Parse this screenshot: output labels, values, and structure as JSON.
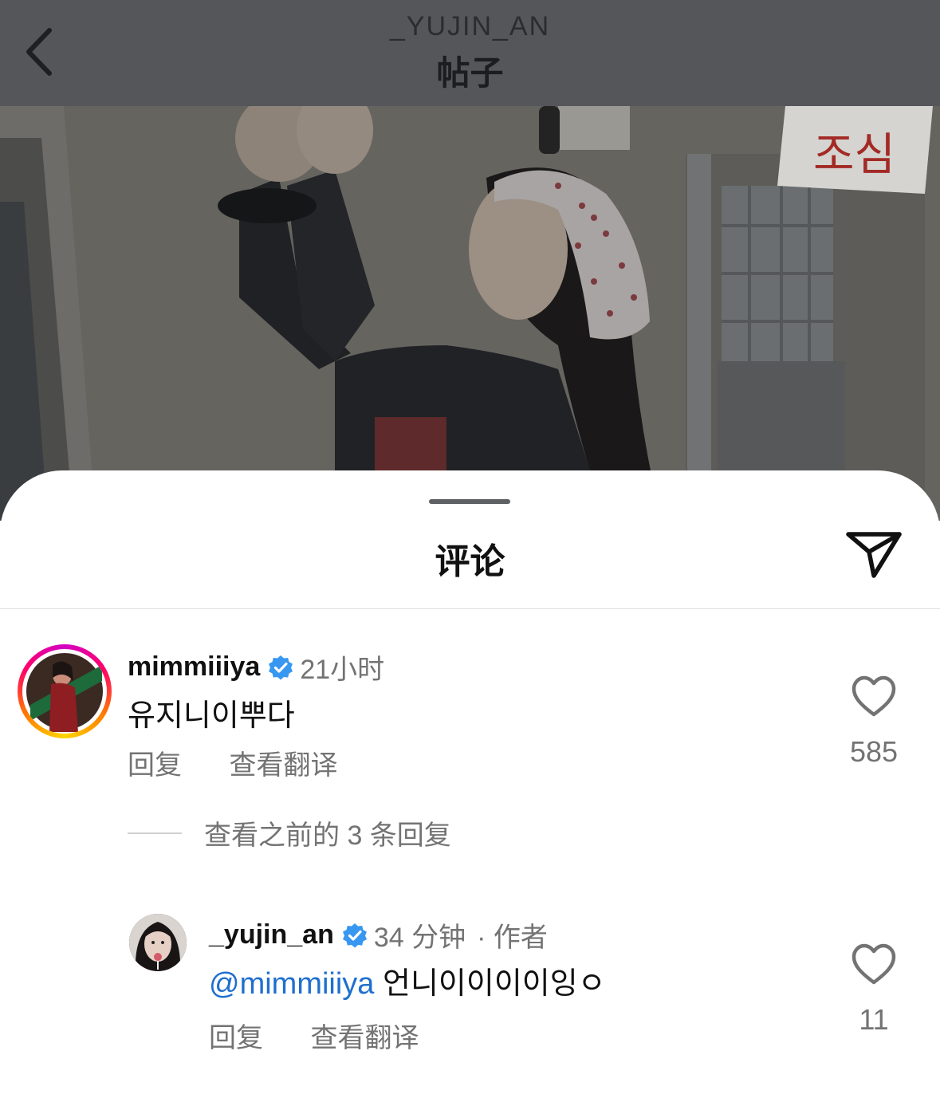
{
  "header": {
    "username": "_YUJIN_AN",
    "title": "帖子"
  },
  "icons": {
    "back": "chevron-left-icon",
    "share": "paper-plane-icon",
    "like": "heart-outline-icon",
    "verified": "verified-badge-icon"
  },
  "colors": {
    "mention": "#1f6fce",
    "verified": "#3897f0",
    "secondary_text": "#737373"
  },
  "sheet": {
    "title": "评论"
  },
  "comments": [
    {
      "username": "mimmiiiya",
      "time": "21小时",
      "text": "유지니이뿌다",
      "reply_label": "回复",
      "translate_label": "查看翻译",
      "likes": "585"
    }
  ],
  "view_replies": "查看之前的 3 条回复",
  "reply": {
    "username": "_yujin_an",
    "time": "34 分钟",
    "author_tag": "· 作者",
    "mention": "@mimmiiiya",
    "text": " 언니이이이이잉ㅇ",
    "reply_label": "回复",
    "translate_label": "查看翻译",
    "likes": "11"
  }
}
